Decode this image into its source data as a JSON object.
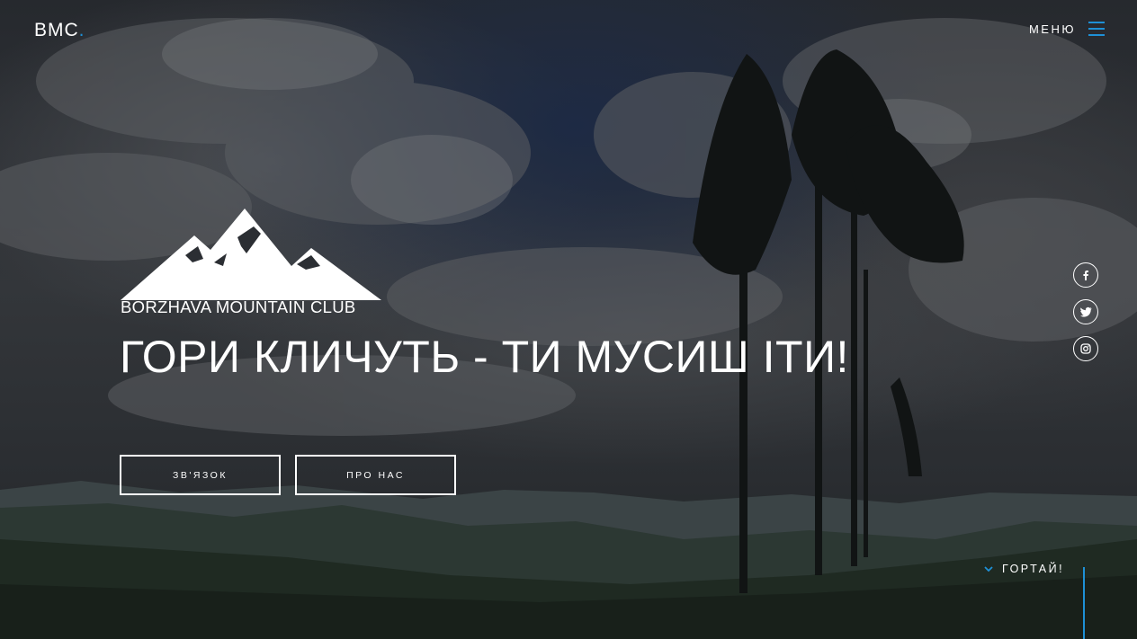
{
  "header": {
    "brand": "BMC",
    "brand_dot": ".",
    "menu_label": "МЕНЮ"
  },
  "hero": {
    "logo_text": "BORZHAVA MOUNTAIN CLUB",
    "headline": "ГОРИ КЛИЧУТЬ - ТИ МУСИШ ІТИ!",
    "buttons": {
      "contact": "ЗВ'ЯЗОК",
      "about": "ПРО НАС"
    }
  },
  "social": {
    "items": [
      {
        "icon": "facebook-icon"
      },
      {
        "icon": "twitter-icon"
      },
      {
        "icon": "instagram-icon"
      }
    ]
  },
  "scroll": {
    "label": "ГОРТАЙ!"
  },
  "colors": {
    "accent": "#1e90d6",
    "text": "#ffffff"
  }
}
